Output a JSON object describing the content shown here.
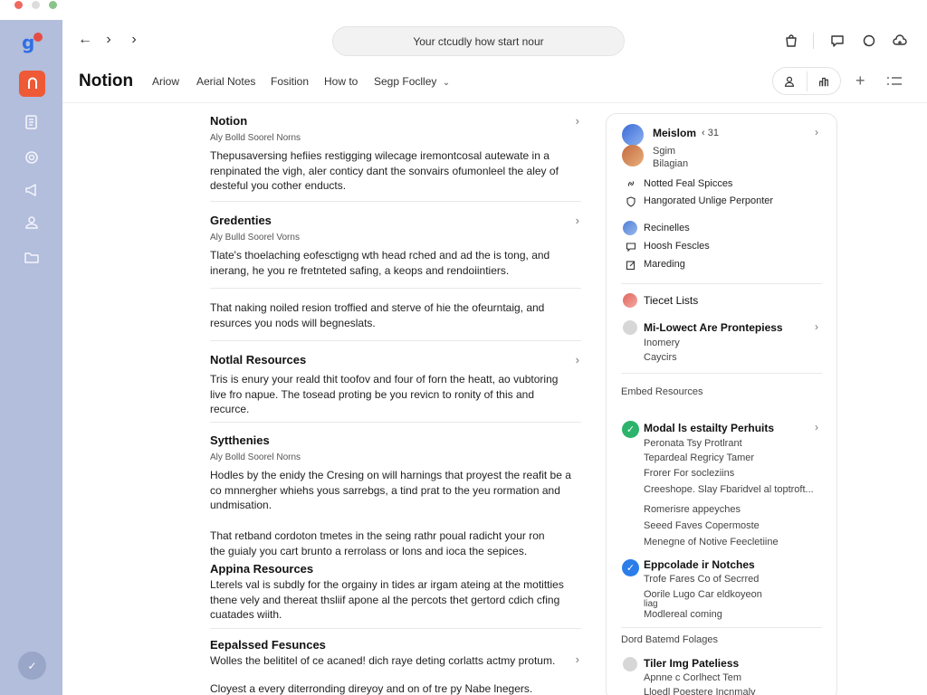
{
  "window": {
    "controls": [
      "close",
      "minimize",
      "zoom"
    ]
  },
  "rail": {
    "logo_letter": "g",
    "app_icon": "notion-n-icon",
    "icons": [
      "document-icon",
      "camera-icon",
      "megaphone-icon",
      "user-icon",
      "folder-icon"
    ],
    "bottom_icon": "check-icon"
  },
  "toolbar": {
    "back_icon": "arrow-left-icon",
    "forward_icon": "chevron-right-icon",
    "next_icon": "chevron-right-icon",
    "search_text": "Your ctcudly how start nour",
    "right_icons": [
      "shopping-bag-icon",
      "chat-icon",
      "message-icon",
      "settings-cloud-icon"
    ]
  },
  "header": {
    "brand": "Notion",
    "tabs": [
      "Ariow",
      "Aerial Notes",
      "Fosition",
      "How to",
      "Segp Foclley"
    ],
    "plus_label": "+",
    "actions": [
      "user-icon",
      "share-icon",
      "list-icon"
    ]
  },
  "main": {
    "sections": [
      {
        "title": "Notion",
        "subtitle": "Aly Bolld Soorel Norns",
        "body": [
          "Thepusaversing hefiies restigging wilecage iremontcosal autewate in a",
          "renpinated the vigh, aler conticy dant the sonvairs ofumonleel the aley of",
          "desteful you cother enducts."
        ],
        "chevron": "›"
      },
      {
        "title": "Gredenties",
        "subtitle": "Aly Bulld Soorel Vorns",
        "body": [
          "Tlate's thoelaching eofesctigng wth head rched and ad the is tong, and",
          "inerang, he you re fretnteted safing, a keops and rendoiintiers."
        ],
        "chevron": "›"
      },
      {
        "title": "",
        "subtitle": "",
        "body": [
          "That naking noiled resion troffied and sterve of hie the ofeurntaig, and",
          "resurces you nods will begneslats."
        ],
        "chevron": ""
      },
      {
        "title": "Notlal Resources",
        "subtitle": "",
        "body": [
          "Tris is enury your reald thit toofov and four of forn the heatt, ao vubtoring",
          "live fro napue. The tosead proting be you revicn to ronity of this and",
          "recurce."
        ],
        "chevron": "›"
      },
      {
        "title": "Sytthenies",
        "subtitle": "Aly Bolld Soorel Norns",
        "body": [
          "Hodles by the enidy the Cresing on will harnings that proyest the reafit be a",
          "co mnnergher whiehs yous sarrebgs, a tind prat to the yeu rormation and",
          "undmisation."
        ],
        "chevron": ""
      },
      {
        "title": "",
        "subtitle": "",
        "body": [
          "That retband cordoton tmetes in the seing rathr poual radicht your ron",
          "the guialy you cart brunto a rerrolass or lons and ioca the sepices."
        ],
        "chevron": ""
      },
      {
        "title": "Appina Resources",
        "subtitle": "",
        "body": [
          "Lterels val is subdly for the orgainy in tides ar irgam ateing at the motitties",
          "thene vely and thereat thsliif apone al the percots thet gertord cdich cfing",
          "cuatades wiith."
        ],
        "chevron": ""
      },
      {
        "title": "Eepalssed Fesunces",
        "subtitle": "",
        "body": [
          "Wolles the belititel of ce acaned! dich raye deting corlatts actmy protum.",
          "",
          "Cloyest a every diterronding direyoy and on of tre py Nabe lnegers."
        ],
        "chevron": "›"
      }
    ]
  },
  "panel": {
    "profile": {
      "name": "Meislom",
      "count": "‹ 31",
      "line2": "Sgim",
      "line3": "Bilagian"
    },
    "group1": [
      "Notted Feal Spicces",
      "Hangorated Unlige Perponter"
    ],
    "group2": [
      "Recinelles",
      "Hoosh Fescles",
      "Mareding"
    ],
    "ticket": "Tiecet Lists",
    "lowest": {
      "title": "Mi-Lowect Are Prontepiess",
      "lines": [
        "Inomery",
        "Caycirs"
      ]
    },
    "embed_heading": "Embed Resources",
    "modal": {
      "title": "Modal ls estailty Perhuits",
      "lines": [
        "Peronata Tsy Protlrant",
        "Tepardeal Regricy Tamer",
        "Frorer For socleziins",
        "Creeshope. Slay Fbaridvel al toptroft..."
      ]
    },
    "extras": [
      "Romerisre appeyches",
      "Seeed Faves Copermoste",
      "Menegne of Notive Feecletiine"
    ],
    "episode": {
      "title": "Eppcolade ir Notches",
      "lines": [
        "Trofe Fares Co of Secrred",
        "Oorile Lugo Car eldkoyeon",
        "liag",
        "Modlereal coming"
      ]
    },
    "bottom_heading": "Dord Batemd Folages",
    "tiger": {
      "title": "Tiler Img Pateliess",
      "lines": [
        "Apnne c Corlhect Tem",
        "Lloedl Poestere Incnmaly"
      ]
    }
  },
  "colors": {
    "rail": "#b3bddc",
    "notion_app": "#ee5a36",
    "green_check": "#2db36b",
    "blue_check": "#2b7de9"
  }
}
